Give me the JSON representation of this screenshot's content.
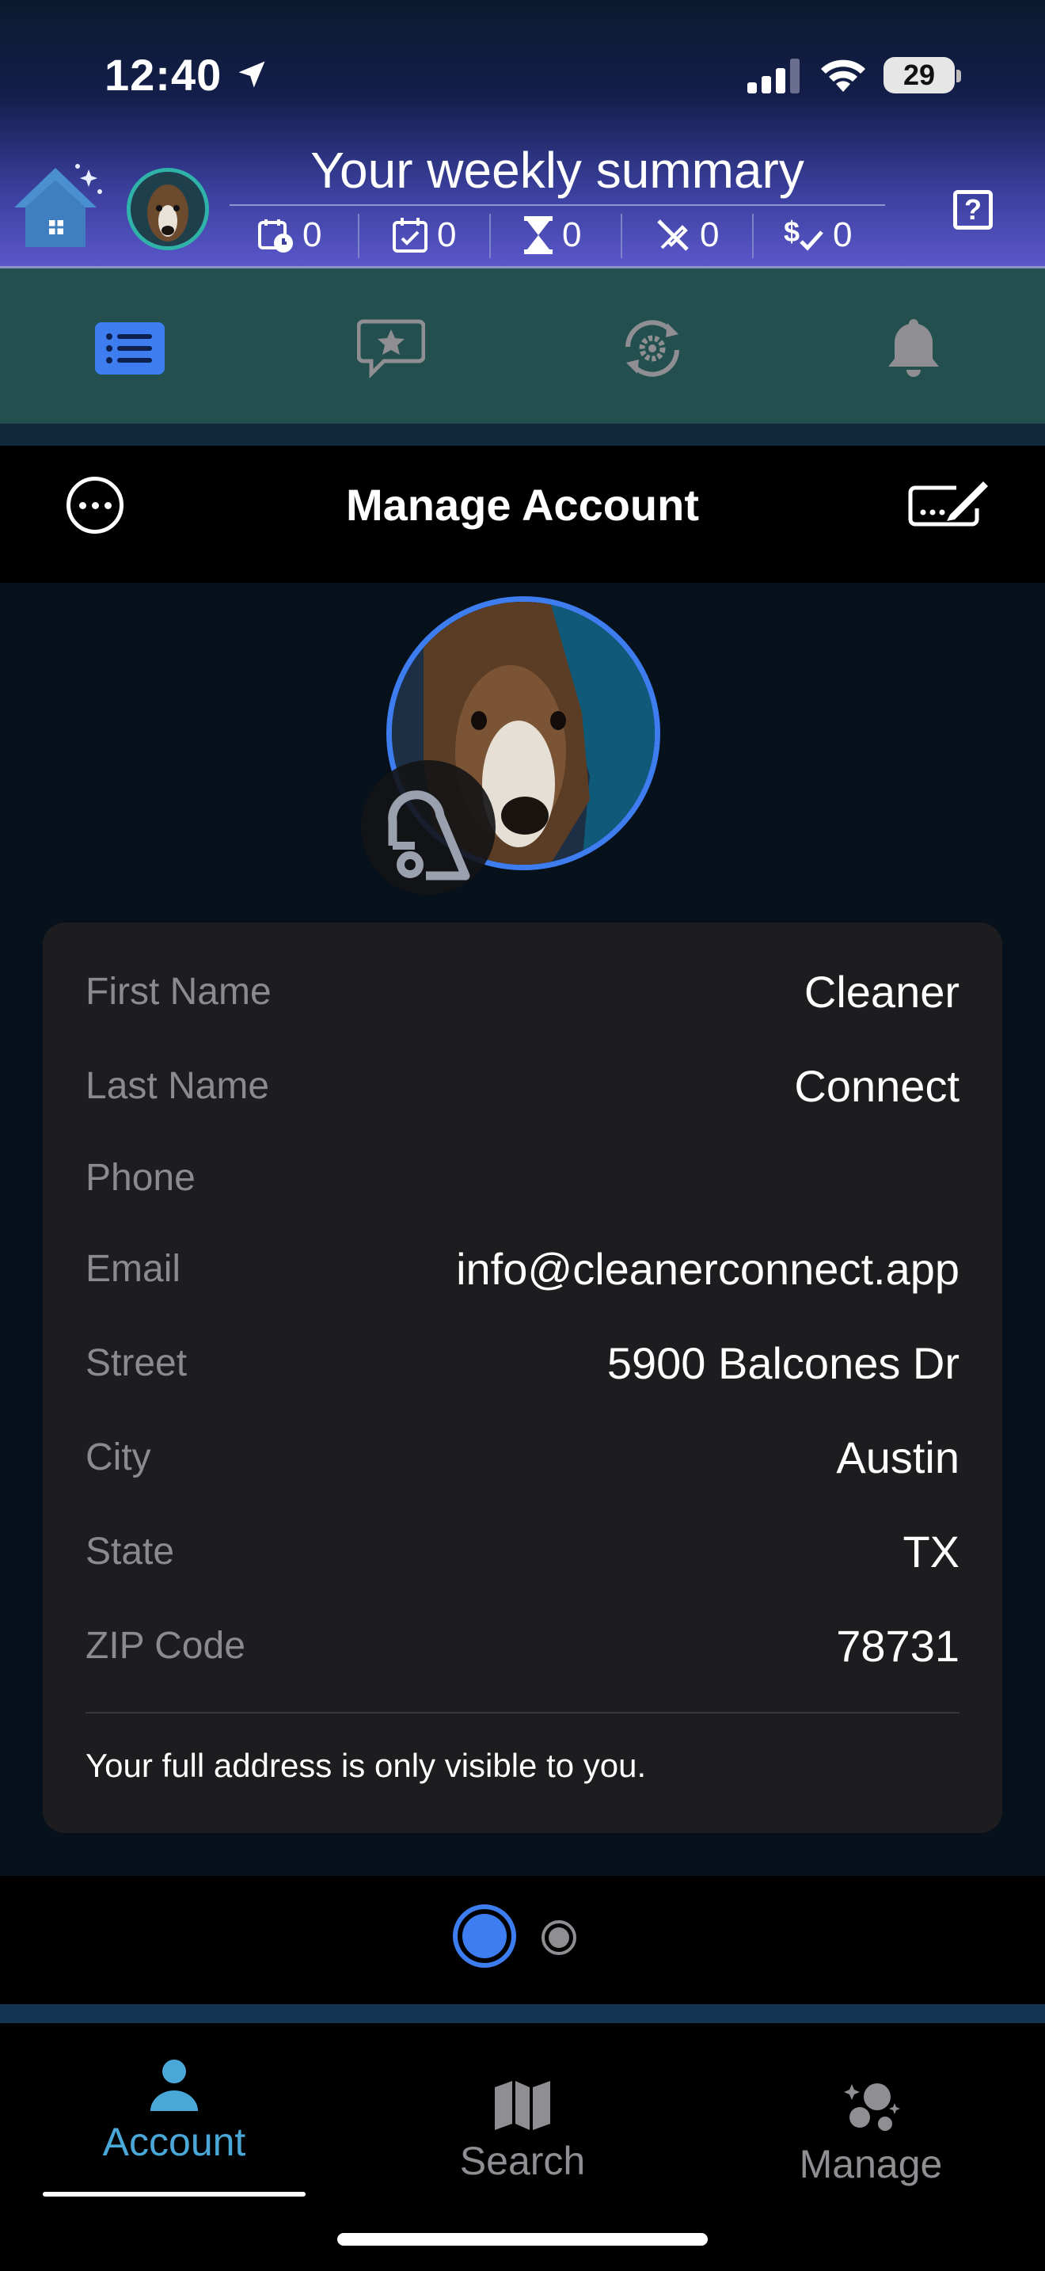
{
  "status_bar": {
    "time": "12:40",
    "battery": "29",
    "icons": [
      "location-arrow-icon",
      "cellular-signal-icon",
      "wifi-icon",
      "battery-icon"
    ]
  },
  "summary": {
    "title": "Your weekly summary",
    "stats": [
      {
        "icon": "calendar-clock-icon",
        "value": "0"
      },
      {
        "icon": "calendar-check-icon",
        "value": "0"
      },
      {
        "icon": "hourglass-icon",
        "value": "0"
      },
      {
        "icon": "cancelled-icon",
        "value": "0"
      },
      {
        "icon": "dollar-check-icon",
        "value": "0"
      }
    ],
    "help_glyph": "?"
  },
  "top_tabs": [
    {
      "name": "list",
      "icon": "list-icon",
      "active": true
    },
    {
      "name": "reviews",
      "icon": "star-bubble-icon",
      "active": false
    },
    {
      "name": "settings",
      "icon": "sync-gear-icon",
      "active": false
    },
    {
      "name": "notifications",
      "icon": "bell-icon",
      "active": false
    }
  ],
  "manage": {
    "title": "Manage Account"
  },
  "account": {
    "fields": [
      {
        "label": "First Name",
        "value": "Cleaner"
      },
      {
        "label": "Last Name",
        "value": "Connect"
      },
      {
        "label": "Phone",
        "value": ""
      },
      {
        "label": "Email",
        "value": "info@cleanerconnect.app"
      },
      {
        "label": "Street",
        "value": "5900 Balcones Dr"
      },
      {
        "label": "City",
        "value": "Austin"
      },
      {
        "label": "State",
        "value": "TX"
      },
      {
        "label": "ZIP Code",
        "value": "78731"
      }
    ],
    "note": "Your full address is only visible to you."
  },
  "pager": {
    "pages": 2,
    "current": 1
  },
  "bottom_tabs": [
    {
      "label": "Account",
      "icon": "person-icon",
      "active": true
    },
    {
      "label": "Search",
      "icon": "map-icon",
      "active": false
    },
    {
      "label": "Manage",
      "icon": "sparkles-icon",
      "active": false
    }
  ],
  "colors": {
    "accent_blue": "#3d7df0",
    "active_tab": "#4aa8d8",
    "tab_strip": "#23504f",
    "inactive_gray": "#8e8e93"
  }
}
